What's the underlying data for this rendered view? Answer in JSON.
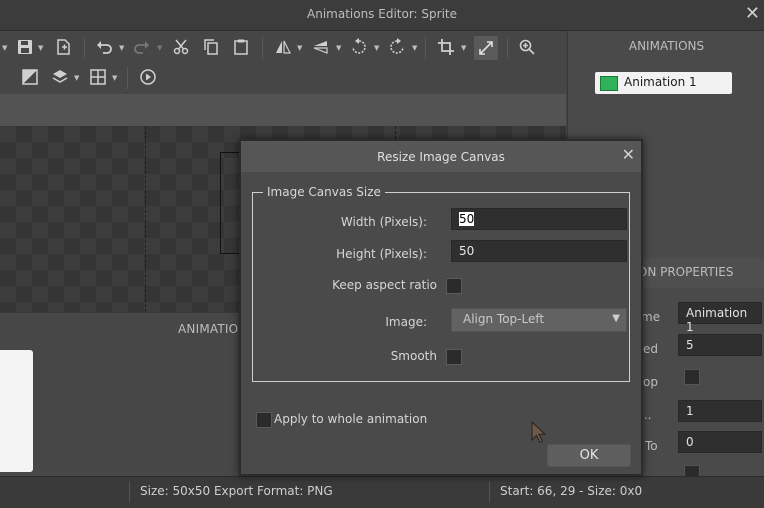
{
  "window": {
    "title": "Animations Editor: Sprite",
    "close_glyph": "✕"
  },
  "toolbar": {
    "row1": [
      "save-icon",
      "save-as-icon",
      "undo-icon",
      "redo-icon",
      "cut-icon",
      "copy-icon",
      "paste-icon",
      "flip-horizontal-icon",
      "flip-vertical-icon",
      "rotate-left-icon",
      "rotate-right-icon",
      "crop-icon",
      "resize-canvas-icon",
      "zoom-icon"
    ],
    "row2": [
      "color-adjust-icon",
      "layers-icon",
      "grid-icon",
      "play-icon"
    ]
  },
  "frames_panel": {
    "header": "ANIMATIO"
  },
  "animations_panel": {
    "header": "ANIMATIONS",
    "items": [
      {
        "label": "Animation 1"
      }
    ]
  },
  "properties_panel": {
    "header": "TION PROPERTIES",
    "rows": [
      {
        "label": "me",
        "value": "Animation 1"
      },
      {
        "label": "ed",
        "value": "5"
      },
      {
        "label": "op",
        "checkbox": true
      },
      {
        "label": "...",
        "value": "1"
      },
      {
        "label": "To",
        "value": "0"
      }
    ]
  },
  "status": {
    "left": "Size: 50x50  Export Format: PNG",
    "right": "Start: 66, 29 - Size: 0x0"
  },
  "dialog": {
    "title": "Resize Image Canvas",
    "close_glyph": "✕",
    "group_title": "Image Canvas Size",
    "width_label": "Width (Pixels):",
    "width_value": "50",
    "height_label": "Height (Pixels):",
    "height_value": "50",
    "keep_aspect_label": "Keep aspect ratio",
    "image_label": "Image:",
    "image_value": "Align Top-Left",
    "smooth_label": "Smooth",
    "apply_label": "Apply to whole animation",
    "ok_label": "OK"
  },
  "colors": {
    "accent_green": "#30b15a",
    "panel": "#4a4a4a"
  }
}
